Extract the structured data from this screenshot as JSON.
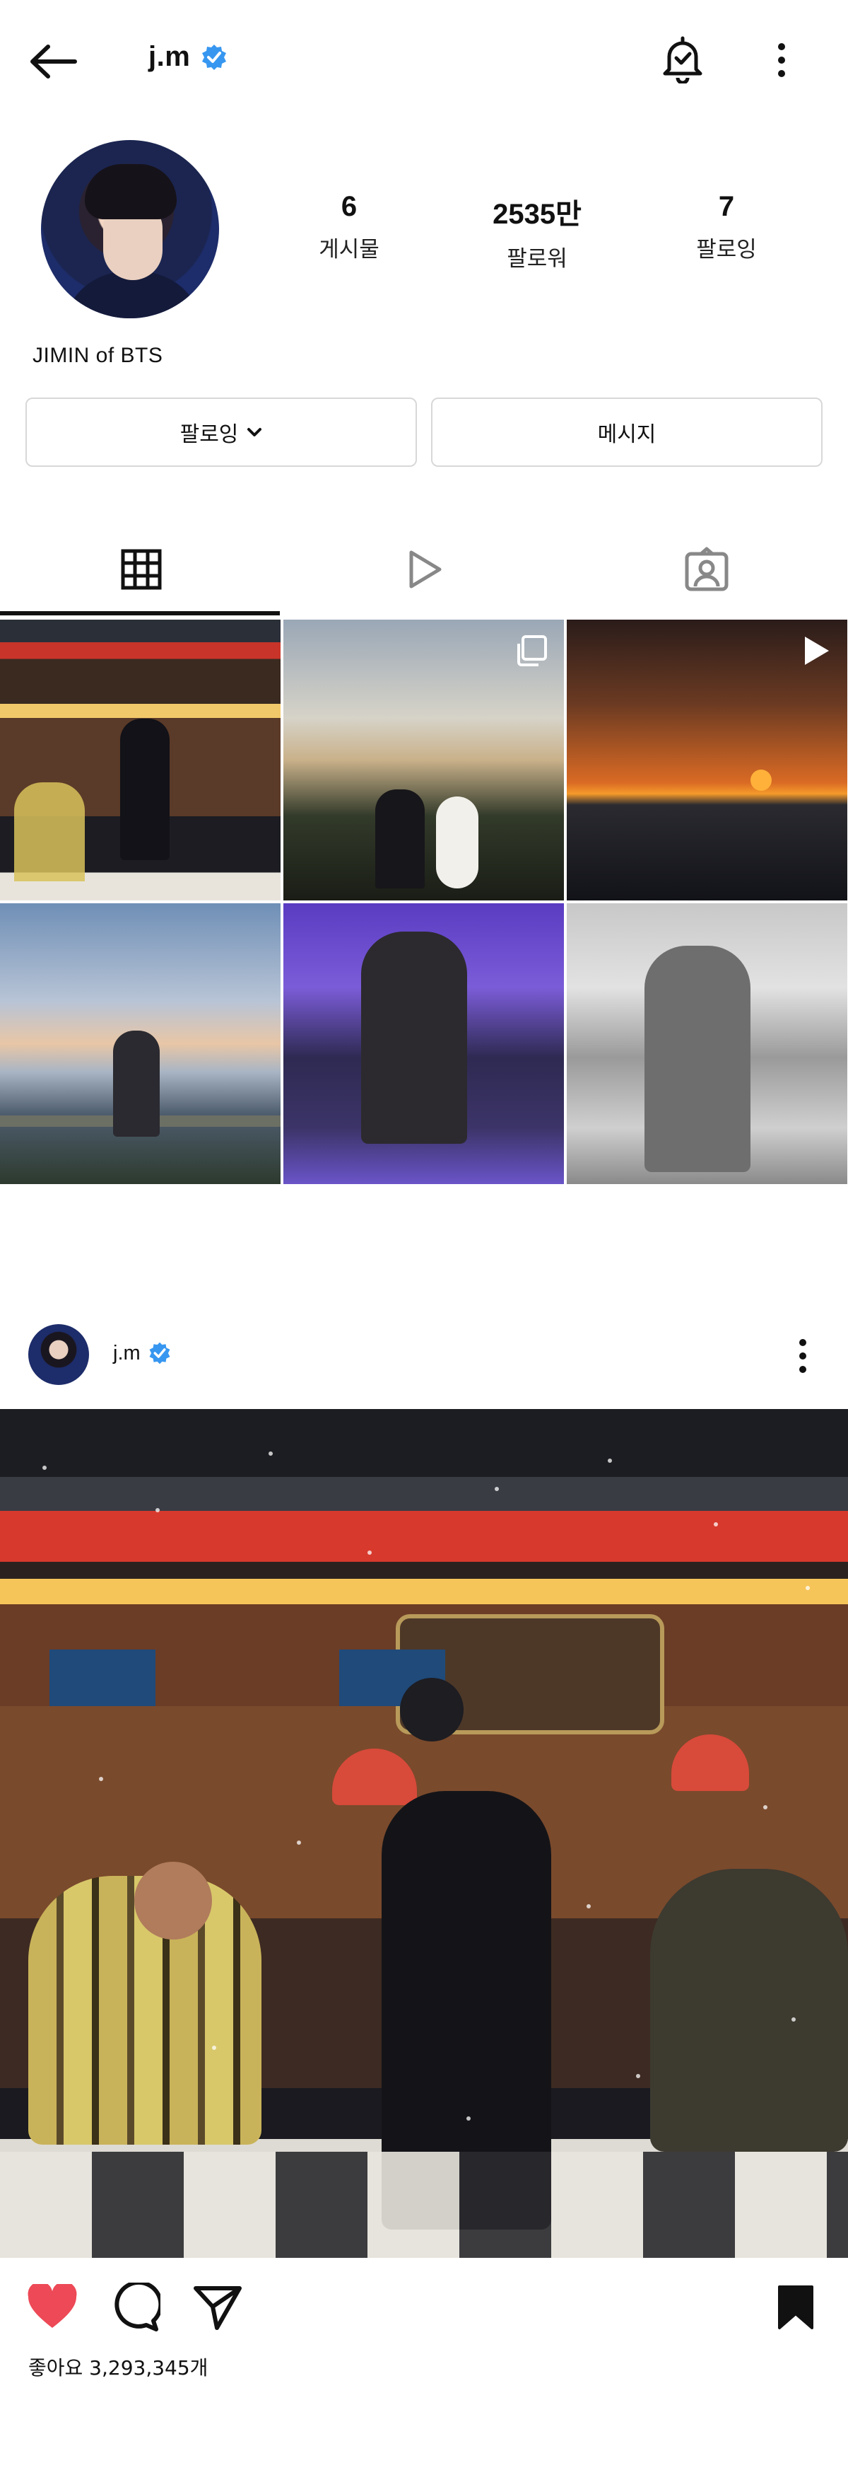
{
  "header": {
    "username": "j.m",
    "icons": {
      "back": "back-arrow-icon",
      "verified": "verified-badge-icon",
      "notifications": "bell-check-icon",
      "more": "more-vertical-icon"
    }
  },
  "profile": {
    "display_name": "JIMIN of BTS",
    "stats": [
      {
        "value": "6",
        "label": "게시물"
      },
      {
        "value": "2535만",
        "label": "팔로워"
      },
      {
        "value": "7",
        "label": "팔로잉"
      }
    ],
    "buttons": {
      "following": "팔로잉",
      "message": "메시지"
    }
  },
  "tabs": [
    {
      "name": "posts-grid",
      "icon": "grid-icon",
      "active": true
    },
    {
      "name": "reels",
      "icon": "play-icon",
      "active": false
    },
    {
      "name": "tagged",
      "icon": "tagged-person-icon",
      "active": false
    }
  ],
  "grid": {
    "items": [
      {
        "icon": ""
      },
      {
        "icon": "multi-photo-icon"
      },
      {
        "icon": "reel-play-icon"
      },
      {
        "icon": ""
      },
      {
        "icon": ""
      },
      {
        "icon": ""
      }
    ]
  },
  "post": {
    "username": "j.m",
    "likes_text": "좋아요 3,293,345개"
  },
  "colors": {
    "verified": "#3797f0",
    "like": "#ed4956",
    "text": "#111111",
    "border": "#d8d8d8"
  }
}
